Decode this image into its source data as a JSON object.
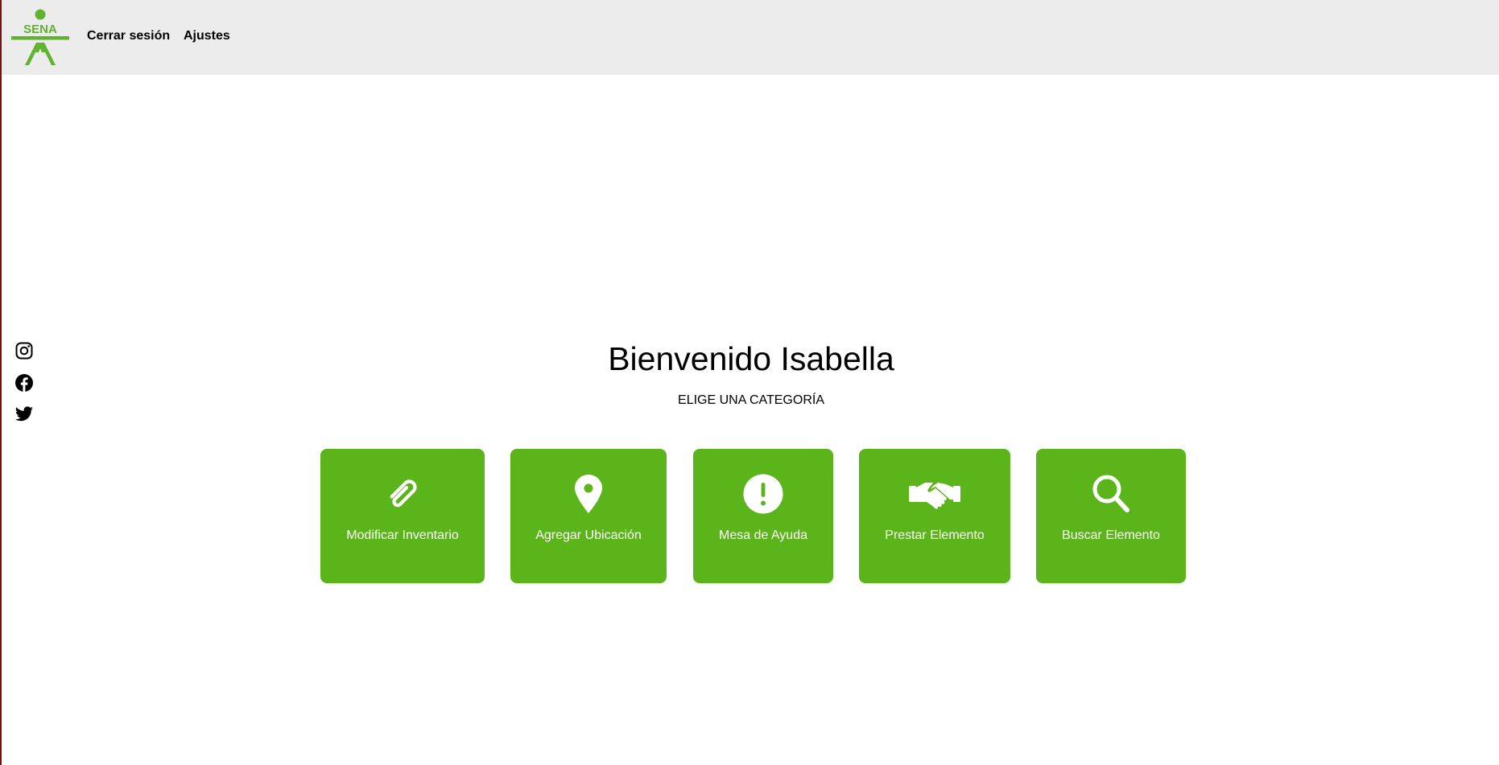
{
  "header": {
    "logo_text": "SENA",
    "logout_label": "Cerrar sesión",
    "settings_label": "Ajustes"
  },
  "social": [
    {
      "icon": "instagram-icon"
    },
    {
      "icon": "facebook-icon"
    },
    {
      "icon": "twitter-icon"
    }
  ],
  "main": {
    "welcome": "Bienvenido Isabella",
    "subtitle": "ELIGE UNA CATEGORÍA",
    "categories": [
      {
        "label": "Modificar Inventario",
        "icon": "paperclip-icon"
      },
      {
        "label": "Agregar Ubicación",
        "icon": "map-pin-icon"
      },
      {
        "label": "Mesa de Ayuda",
        "icon": "exclamation-circle-icon"
      },
      {
        "label": "Prestar Elemento",
        "icon": "handshake-icon"
      },
      {
        "label": "Buscar Elemento",
        "icon": "search-icon"
      }
    ]
  },
  "colors": {
    "brand_green": "#5cb41b",
    "header_bg": "#ececec",
    "logo_green": "#5fb32e"
  }
}
